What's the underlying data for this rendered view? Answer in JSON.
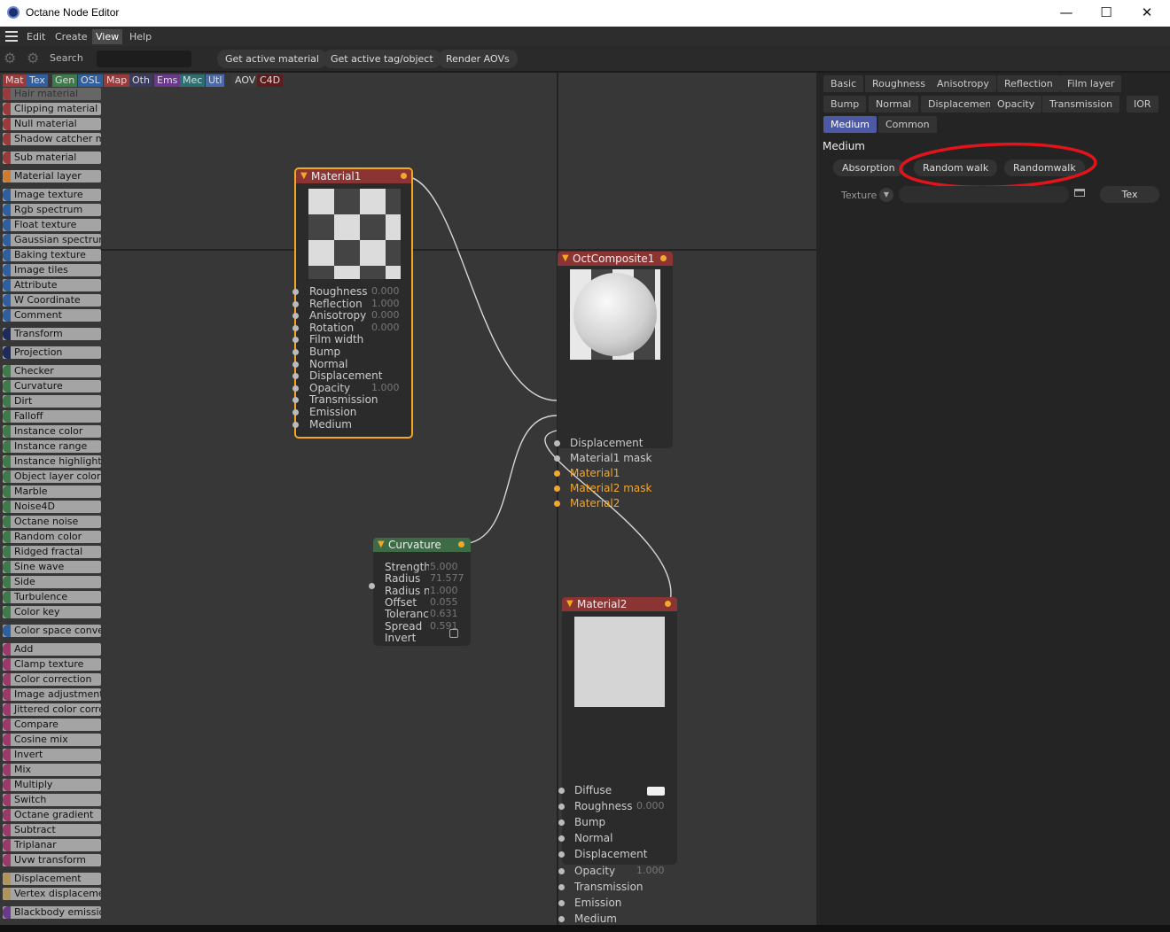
{
  "window": {
    "title": "Octane Node Editor",
    "minimize": "—",
    "maximize": "☐",
    "close": "✕"
  },
  "menu": [
    "Edit",
    "Create",
    "View",
    "Help"
  ],
  "menu_active": "View",
  "toolbar": {
    "search_label": "Search",
    "search_value": "",
    "buttons": [
      "Get active material",
      "Get active tag/object",
      "Render AOVs"
    ]
  },
  "categories": [
    {
      "label": "Mat",
      "color": "#9b3a3a"
    },
    {
      "label": "Tex",
      "color": "#2f5f9e"
    },
    {
      "label": "Gen",
      "color": "#3f7a4a"
    },
    {
      "label": "OSL",
      "color": "#2f5f9e"
    },
    {
      "label": "Map",
      "color": "#9b3a3a"
    },
    {
      "label": "Oth",
      "color": "#3b3b5e"
    },
    {
      "label": "Ems",
      "color": "#6a3a8a"
    },
    {
      "label": "Mec",
      "color": "#2d6f6f"
    },
    {
      "label": "Utl",
      "color": "#4a6aa8"
    },
    {
      "label": "AOV",
      "color": "#3a3a3a"
    },
    {
      "label": "C4D",
      "color": "#5a1e1e"
    }
  ],
  "node_list": [
    {
      "label": "Hair material",
      "color": "#9b3a3a"
    },
    {
      "label": "Clipping material",
      "color": "#9b3a3a"
    },
    {
      "label": "Null material",
      "color": "#9b3a3a"
    },
    {
      "label": "Shadow catcher m",
      "color": "#9b3a3a"
    },
    {
      "label": "Sub material",
      "color": "#9b3a3a"
    },
    {
      "label": "Material layer",
      "color": "#d07a30"
    },
    {
      "label": "Image texture",
      "color": "#2f5f9e"
    },
    {
      "label": "Rgb spectrum",
      "color": "#2f5f9e"
    },
    {
      "label": "Float texture",
      "color": "#2f5f9e"
    },
    {
      "label": "Gaussian spectrun",
      "color": "#2f5f9e"
    },
    {
      "label": "Baking texture",
      "color": "#2f5f9e"
    },
    {
      "label": "Image tiles",
      "color": "#2f5f9e"
    },
    {
      "label": "Attribute",
      "color": "#2f5f9e"
    },
    {
      "label": "W Coordinate",
      "color": "#2f5f9e"
    },
    {
      "label": "Comment",
      "color": "#2f5f9e"
    },
    {
      "label": "Transform",
      "color": "#1e2a5a"
    },
    {
      "label": "Projection",
      "color": "#1e2a5a"
    },
    {
      "label": "Checker",
      "color": "#3f7a4a"
    },
    {
      "label": "Curvature",
      "color": "#3f7a4a"
    },
    {
      "label": "Dirt",
      "color": "#3f7a4a"
    },
    {
      "label": "Falloff",
      "color": "#3f7a4a"
    },
    {
      "label": "Instance color",
      "color": "#3f7a4a"
    },
    {
      "label": "Instance range",
      "color": "#3f7a4a"
    },
    {
      "label": "Instance highlight",
      "color": "#3f7a4a"
    },
    {
      "label": "Object layer color",
      "color": "#3f7a4a"
    },
    {
      "label": "Marble",
      "color": "#3f7a4a"
    },
    {
      "label": "Noise4D",
      "color": "#3f7a4a"
    },
    {
      "label": "Octane noise",
      "color": "#3f7a4a"
    },
    {
      "label": "Random color",
      "color": "#3f7a4a"
    },
    {
      "label": "Ridged fractal",
      "color": "#3f7a4a"
    },
    {
      "label": "Sine wave",
      "color": "#3f7a4a"
    },
    {
      "label": "Side",
      "color": "#3f7a4a"
    },
    {
      "label": "Turbulence",
      "color": "#3f7a4a"
    },
    {
      "label": "Color key",
      "color": "#3f7a4a"
    },
    {
      "label": "Color space conve",
      "color": "#2f5f9e"
    },
    {
      "label": "Add",
      "color": "#9b3a6a"
    },
    {
      "label": "Clamp texture",
      "color": "#9b3a6a"
    },
    {
      "label": "Color correction",
      "color": "#9b3a6a"
    },
    {
      "label": "Image adjustment",
      "color": "#9b3a6a"
    },
    {
      "label": "Jittered color corre",
      "color": "#9b3a6a"
    },
    {
      "label": "Compare",
      "color": "#9b3a6a"
    },
    {
      "label": "Cosine mix",
      "color": "#9b3a6a"
    },
    {
      "label": "Invert",
      "color": "#9b3a6a"
    },
    {
      "label": "Mix",
      "color": "#9b3a6a"
    },
    {
      "label": "Multiply",
      "color": "#9b3a6a"
    },
    {
      "label": "Switch",
      "color": "#9b3a6a"
    },
    {
      "label": "Octane gradient",
      "color": "#9b3a6a"
    },
    {
      "label": "Subtract",
      "color": "#9b3a6a"
    },
    {
      "label": "Triplanar",
      "color": "#9b3a6a"
    },
    {
      "label": "Uvw transform",
      "color": "#9b3a6a"
    },
    {
      "label": "Displacement",
      "color": "#b0955a"
    },
    {
      "label": "Vertex displaceme",
      "color": "#b0955a"
    },
    {
      "label": "Blackbody emissio",
      "color": "#6a3a8a"
    }
  ],
  "nodes": {
    "material1": {
      "title": "Material1",
      "ports": [
        {
          "label": "Roughness",
          "value": "0.000"
        },
        {
          "label": "Reflection",
          "value": "1.000"
        },
        {
          "label": "Anisotropy",
          "value": "0.000"
        },
        {
          "label": "Rotation",
          "value": "0.000"
        },
        {
          "label": "Film width",
          "value": ""
        },
        {
          "label": "Bump",
          "value": ""
        },
        {
          "label": "Normal",
          "value": ""
        },
        {
          "label": "Displacement",
          "value": ""
        },
        {
          "label": "Opacity",
          "value": "1.000"
        },
        {
          "label": "Transmission",
          "value": ""
        },
        {
          "label": "Emission",
          "value": ""
        },
        {
          "label": "Medium",
          "value": ""
        }
      ]
    },
    "composite": {
      "title": "OctComposite1",
      "ports": [
        {
          "label": "Displacement",
          "on": false
        },
        {
          "label": "Material1 mask",
          "on": false
        },
        {
          "label": "Material1",
          "on": true
        },
        {
          "label": "Material2 mask",
          "on": true
        },
        {
          "label": "Material2",
          "on": true
        }
      ]
    },
    "curvature": {
      "title": "Curvature",
      "ports": [
        {
          "label": "Strength",
          "value": "5.000"
        },
        {
          "label": "Radius",
          "value": "71.577"
        },
        {
          "label": "Radius n",
          "value": "1.000"
        },
        {
          "label": "Offset",
          "value": "0.055"
        },
        {
          "label": "Toleranc",
          "value": "0.631"
        },
        {
          "label": "Spread",
          "value": "0.591"
        },
        {
          "label": "Invert",
          "value": ""
        }
      ]
    },
    "material2": {
      "title": "Material2",
      "ports": [
        {
          "label": "Diffuse",
          "value": ""
        },
        {
          "label": "Roughness",
          "value": "0.000"
        },
        {
          "label": "Bump",
          "value": ""
        },
        {
          "label": "Normal",
          "value": ""
        },
        {
          "label": "Displacement",
          "value": ""
        },
        {
          "label": "Opacity",
          "value": "1.000"
        },
        {
          "label": "Transmission",
          "value": ""
        },
        {
          "label": "Emission",
          "value": ""
        },
        {
          "label": "Medium",
          "value": ""
        }
      ]
    }
  },
  "properties": {
    "tabs_row1": [
      "Basic",
      "Roughness",
      "Anisotropy",
      "Reflection",
      "Film layer"
    ],
    "tabs_row2": [
      "Bump",
      "Normal",
      "Displacement",
      "Opacity",
      "Transmission",
      "IOR"
    ],
    "tabs_row3": [
      "Medium",
      "Common"
    ],
    "selected_tab": "Medium",
    "section_title": "Medium",
    "medium_options": [
      "Absorption",
      "Random walk",
      "Randomwalk"
    ],
    "texture_label": "Texture",
    "texture_value": "",
    "tex_button": "Tex",
    "annotation_color": "#e0141a"
  }
}
